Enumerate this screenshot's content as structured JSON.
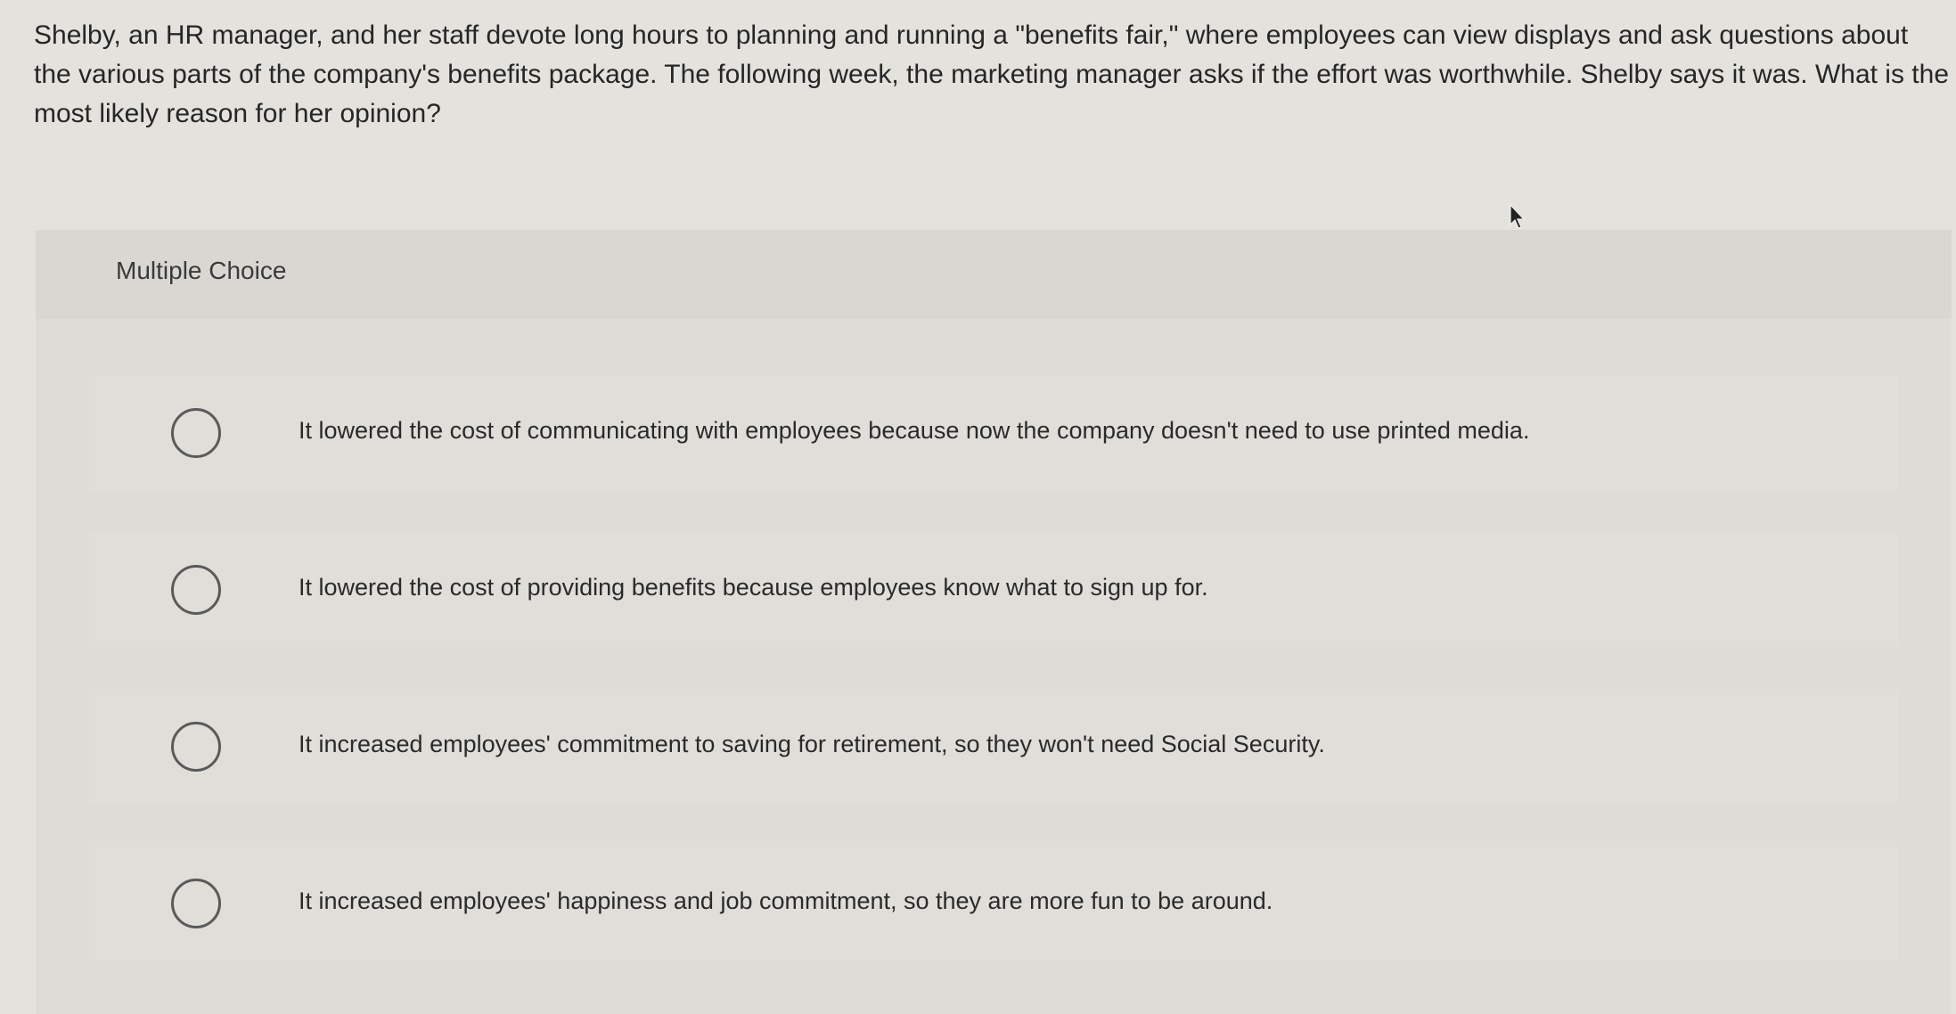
{
  "question": {
    "text": "Shelby, an HR manager, and her staff devote long hours to planning and running a \"benefits fair,\" where employees can view displays and ask questions about the various parts of the company's benefits package. The following week, the marketing manager asks if the effort was worthwhile. Shelby says it was. What is the most likely reason for her opinion?"
  },
  "panel": {
    "title": "Multiple Choice"
  },
  "options": [
    {
      "label": "It lowered the cost of communicating with employees because now the company doesn't need to use printed media."
    },
    {
      "label": "It lowered the cost of providing benefits because employees know what to sign up for."
    },
    {
      "label": "It increased employees' commitment to saving for retirement, so they won't need Social Security."
    },
    {
      "label": "It increased employees' happiness and job commitment, so they are more fun to be around."
    }
  ],
  "icons": {
    "radio": "radio-circle-icon",
    "cursor": "mouse-pointer-icon"
  }
}
